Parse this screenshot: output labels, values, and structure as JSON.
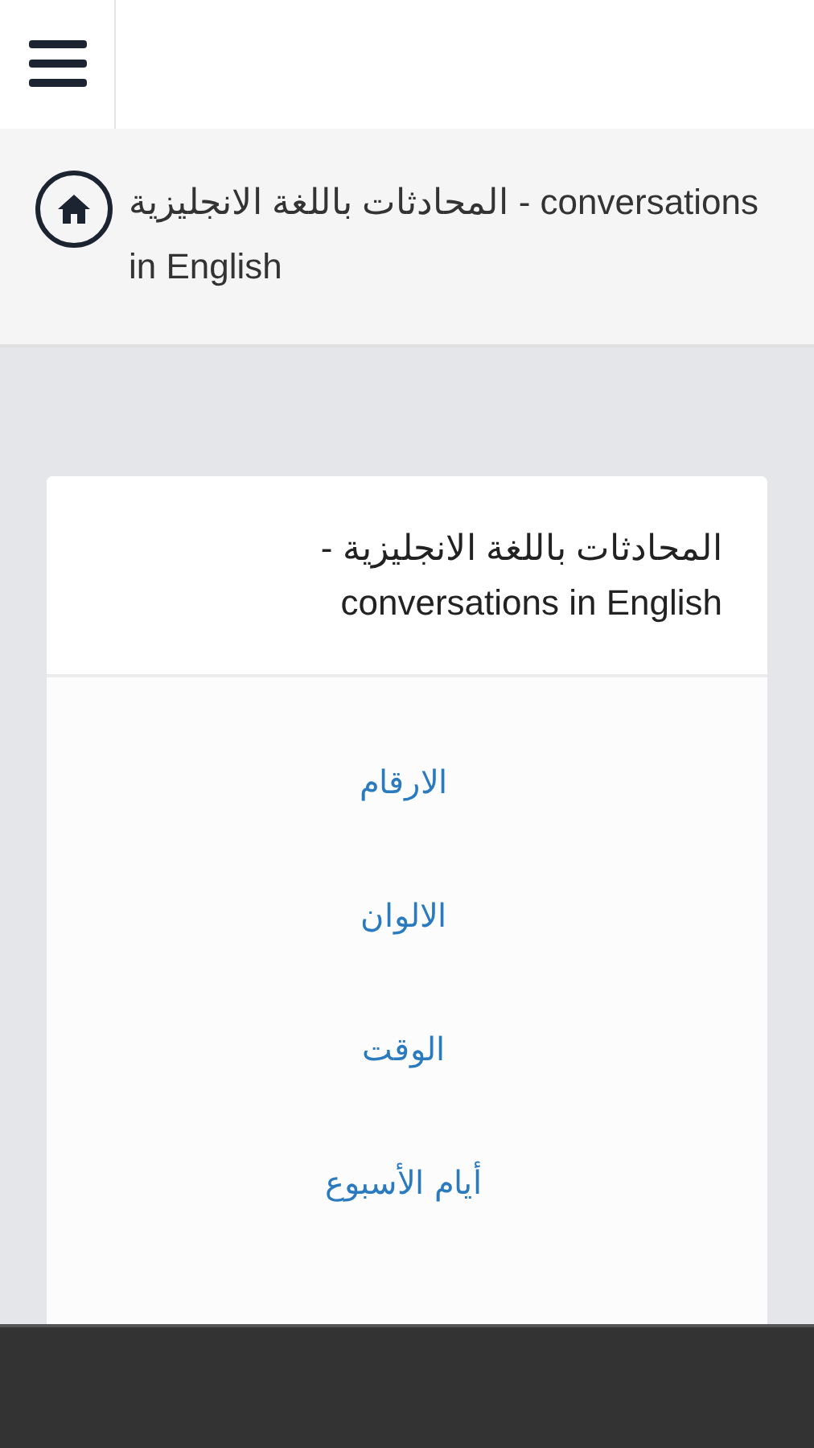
{
  "breadcrumb": {
    "title": "المحادثات باللغة الانجليزية - conversations in English"
  },
  "card": {
    "title": "المحادثات باللغة الانجليزية - conversations in English",
    "links": [
      "الارقام",
      "الالوان",
      "الوقت",
      "أيام الأسبوع"
    ]
  }
}
